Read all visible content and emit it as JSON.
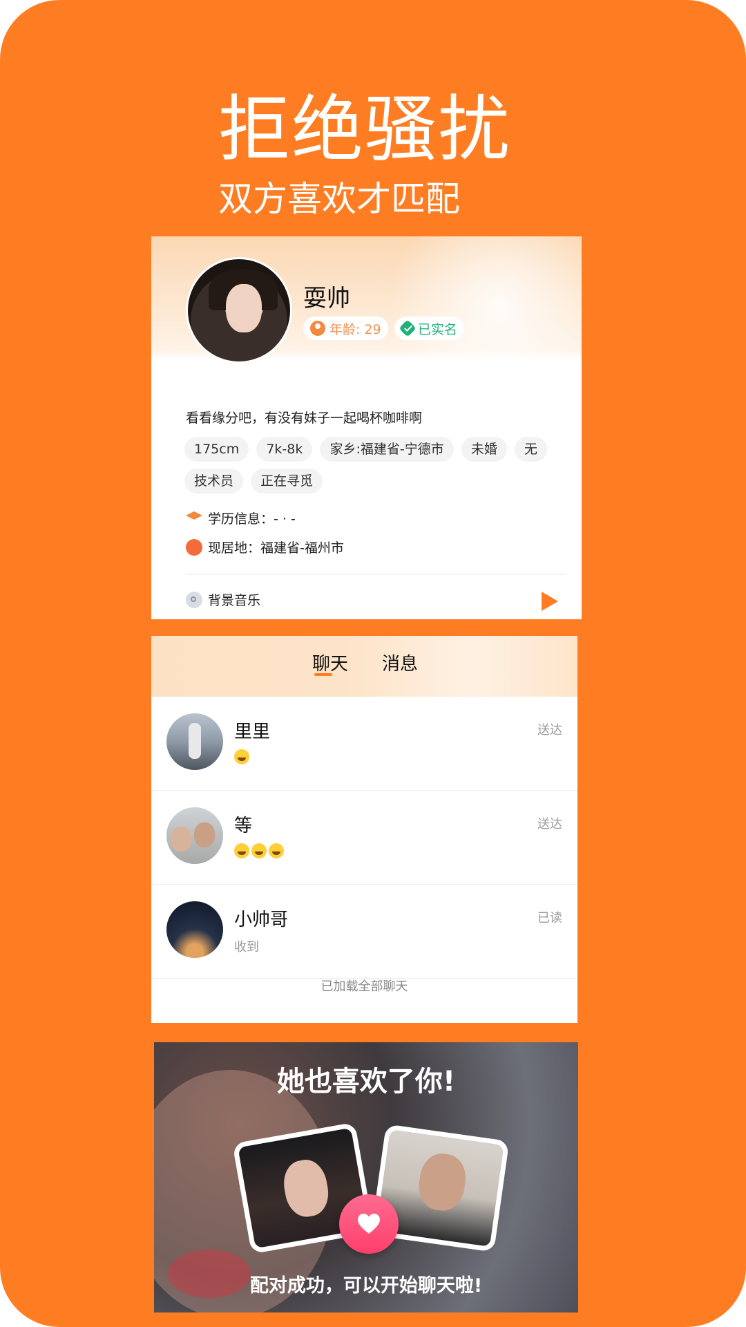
{
  "promo": {
    "headline": "拒绝骚扰",
    "subline": "双方喜欢才匹配"
  },
  "profile": {
    "name": "耍帅",
    "age_label": "年龄: 29",
    "verified_label": "已实名",
    "bio": "看看缘分吧，有没有妹子一起喝杯咖啡啊",
    "tags": [
      "175cm",
      "7k-8k",
      "家乡:福建省-宁德市",
      "未婚",
      "无",
      "技术员",
      "正在寻觅"
    ],
    "education_label": "学历信息：- · -",
    "location_label": "现居地：福建省-福州市",
    "music_label": "背景音乐"
  },
  "chat": {
    "tabs": [
      "聊天",
      "消息"
    ],
    "rows": [
      {
        "name": "里里",
        "preview": "",
        "status": "送达",
        "emoji_count": 1
      },
      {
        "name": "等",
        "preview": "",
        "status": "送达",
        "emoji_count": 3
      },
      {
        "name": "小帅哥",
        "preview": "收到",
        "status": "已读",
        "emoji_count": 0
      }
    ],
    "footer": "已加载全部聊天"
  },
  "match": {
    "title": "她也喜欢了你!",
    "subtitle": "配对成功，可以开始聊天啦!"
  },
  "colors": {
    "brand_orange": "#ff7d22",
    "verified_green": "#22b57a",
    "heart_pink": "#ff4f78"
  }
}
